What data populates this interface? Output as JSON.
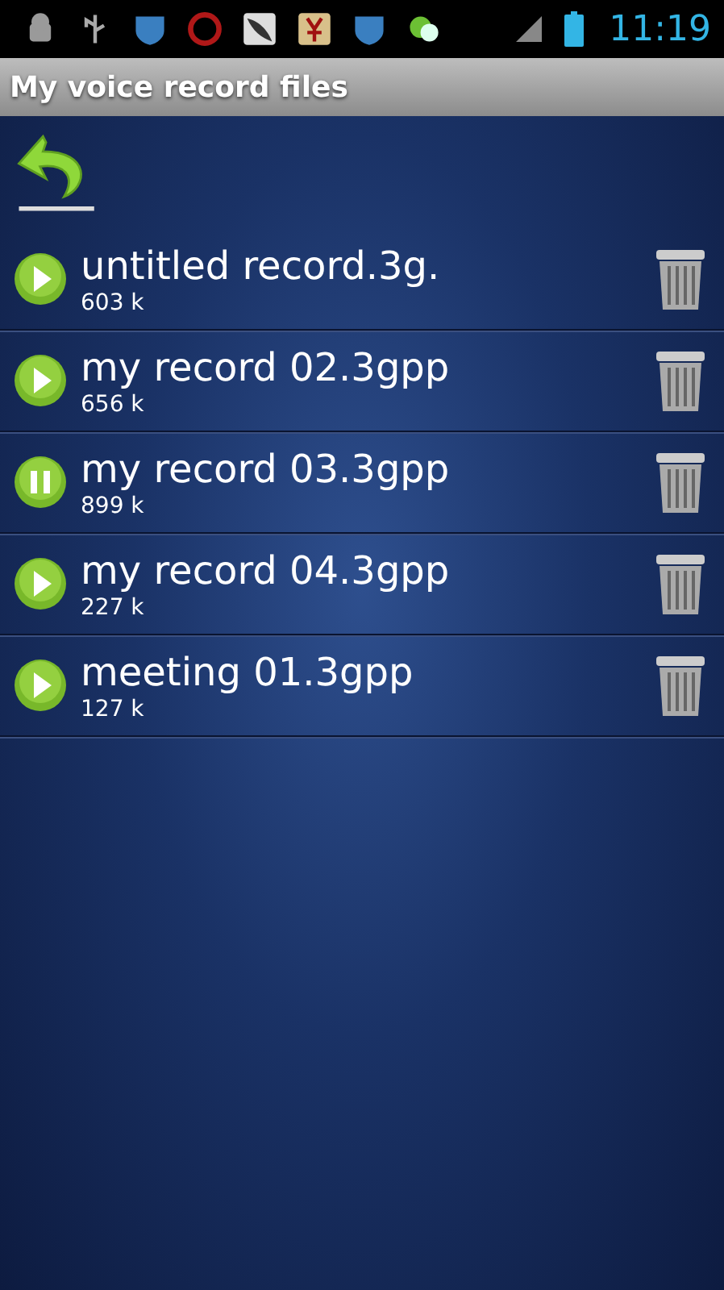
{
  "status_bar": {
    "time": "11:19"
  },
  "title_bar": {
    "title": "My voice record files"
  },
  "files": [
    {
      "name": "untitled record.3g.",
      "size": "603 k",
      "playing": false
    },
    {
      "name": "my record 02.3gpp",
      "size": "656 k",
      "playing": false
    },
    {
      "name": "my record 03.3gpp",
      "size": "899 k",
      "playing": true
    },
    {
      "name": "my record 04.3gpp",
      "size": "227 k",
      "playing": false
    },
    {
      "name": "meeting 01.3gpp",
      "size": "127 k",
      "playing": false
    }
  ]
}
